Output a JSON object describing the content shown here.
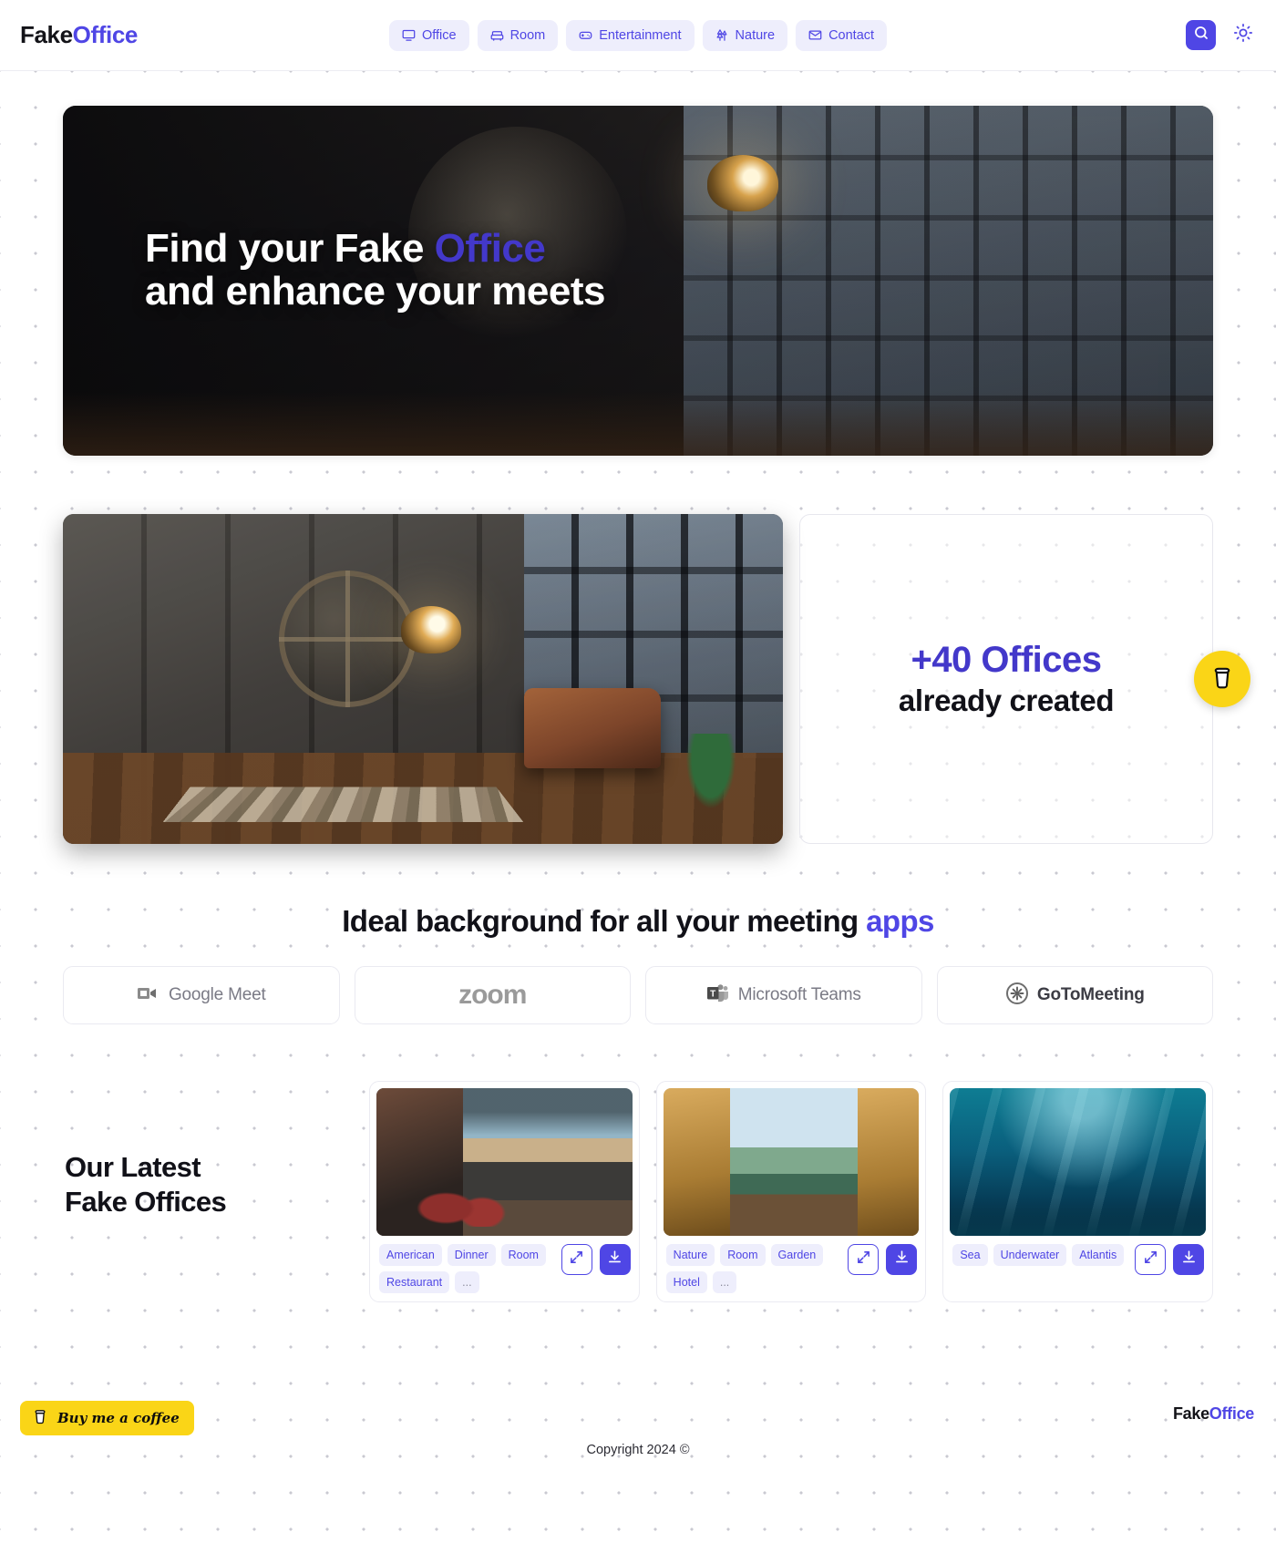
{
  "header": {
    "brand_part1": "Fake",
    "brand_part2": "Office",
    "nav": [
      {
        "label": "Office",
        "icon": "monitor-icon"
      },
      {
        "label": "Room",
        "icon": "sofa-icon"
      },
      {
        "label": "Entertainment",
        "icon": "gamepad-icon"
      },
      {
        "label": "Nature",
        "icon": "trees-icon"
      },
      {
        "label": "Contact",
        "icon": "mail-icon"
      }
    ],
    "search_icon": "search-icon",
    "theme_icon": "sun-icon"
  },
  "hero": {
    "line1_a": "Find your Fake ",
    "line1_b": "Office",
    "line2": "and enhance your meets"
  },
  "stat": {
    "big": "+40 Offices",
    "sub": "already created",
    "fab_icon": "coffee-cup-icon"
  },
  "apps": {
    "title_a": "Ideal background for all your meeting ",
    "title_b": "apps",
    "items": [
      {
        "label": "Google Meet",
        "icon": "google-meet-icon"
      },
      {
        "label": "zoom",
        "icon": "zoom-icon"
      },
      {
        "label": "Microsoft Teams",
        "icon": "microsoft-teams-icon"
      },
      {
        "label": "GoToMeeting",
        "icon": "gotomeeting-icon"
      }
    ]
  },
  "latest": {
    "heading_line1": "Our Latest",
    "heading_line2": "Fake Offices",
    "cards": [
      {
        "thumb": "diner-by-the-road",
        "tags": [
          "American",
          "Dinner",
          "Room",
          "Restaurant",
          "..."
        ],
        "expand_icon": "expand-icon",
        "download_icon": "download-icon"
      },
      {
        "thumb": "lakeside-hotel-room",
        "tags": [
          "Nature",
          "Room",
          "Garden",
          "Hotel",
          "..."
        ],
        "expand_icon": "expand-icon",
        "download_icon": "download-icon"
      },
      {
        "thumb": "underwater-atlantis",
        "tags": [
          "Sea",
          "Underwater",
          "Atlantis"
        ],
        "expand_icon": "expand-icon",
        "download_icon": "download-icon"
      }
    ]
  },
  "footer": {
    "buy_coffee_label": "Buy me a coffee",
    "buy_coffee_icon": "coffee-cup-icon",
    "brand_part1": "Fake",
    "brand_part2": "Office",
    "copyright": "Copyright 2024 ©"
  },
  "colors": {
    "accent": "#4f46e5",
    "accent_dark": "#4338ca",
    "accent_soft_bg": "#eeeefc",
    "coffee_yellow": "#fad517"
  }
}
